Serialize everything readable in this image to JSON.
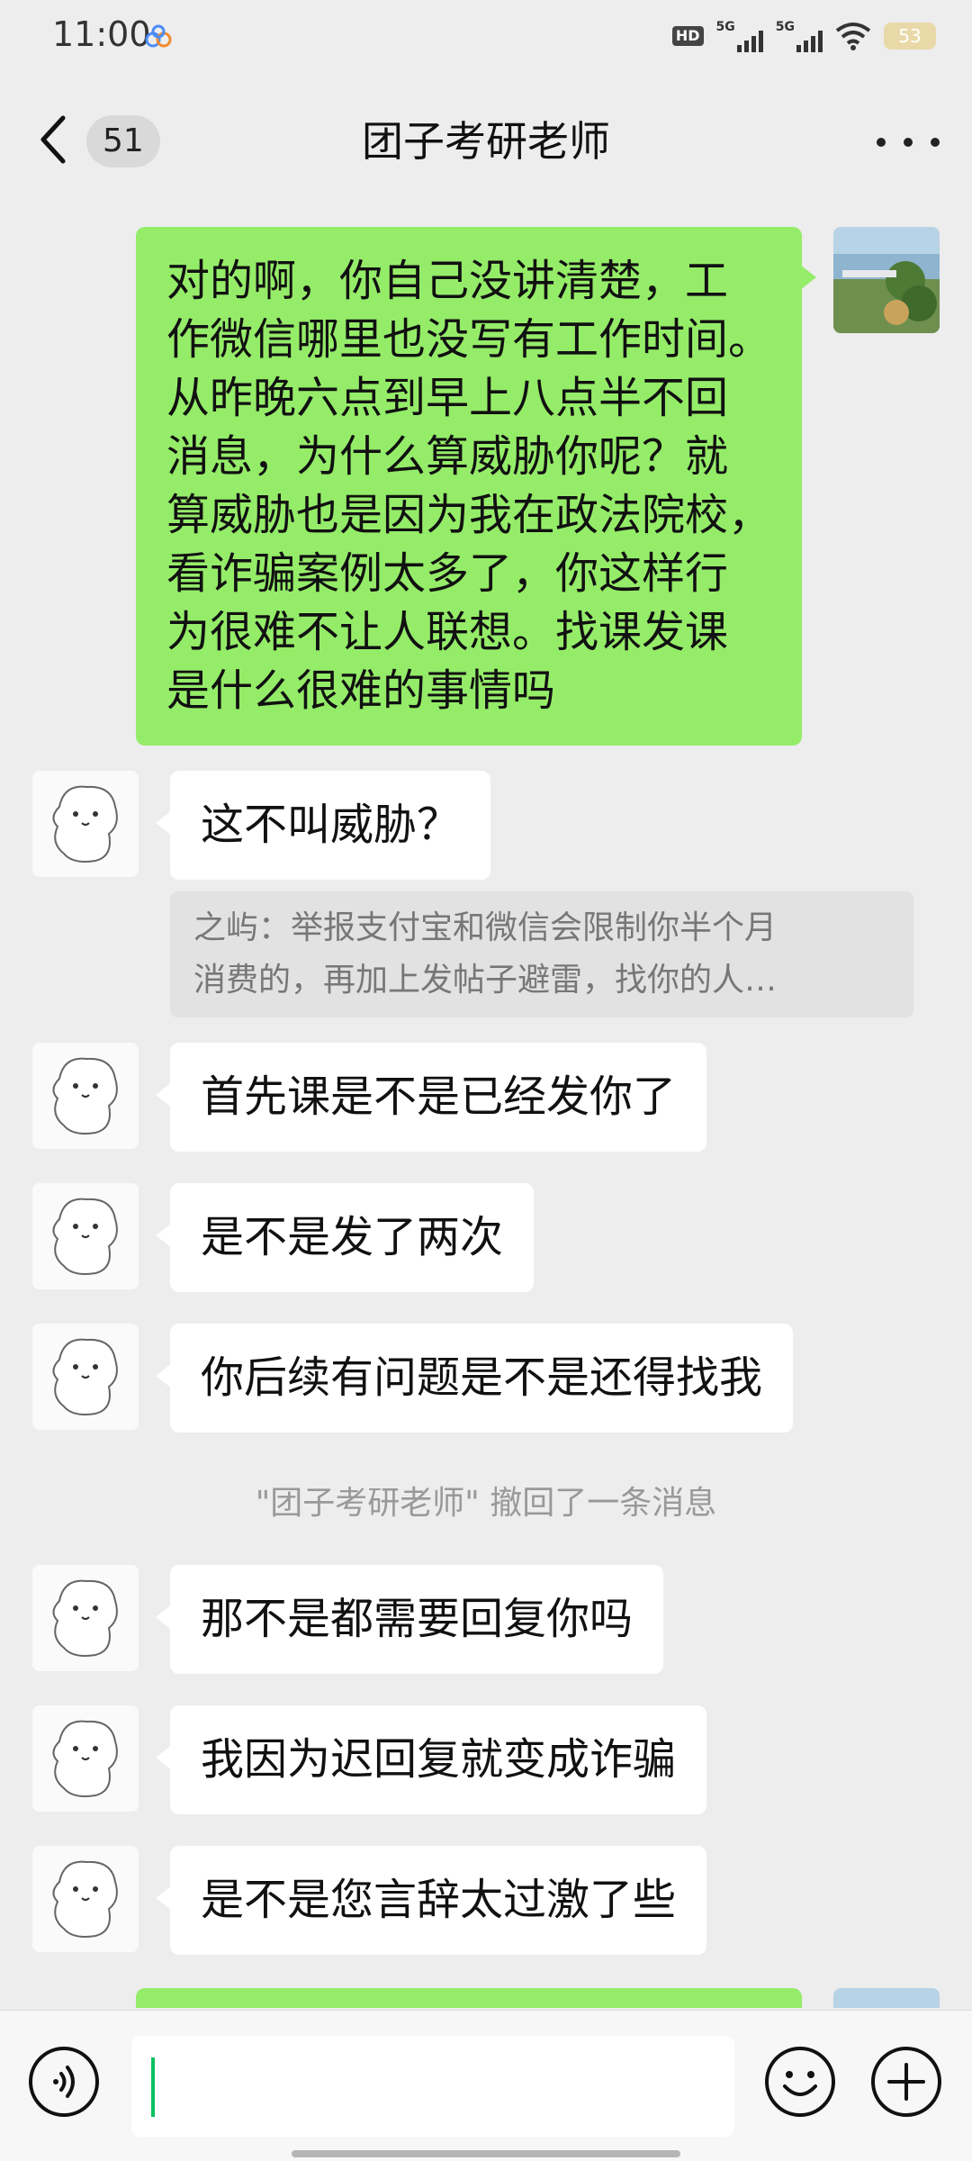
{
  "status_bar": {
    "time": "11:00",
    "battery": "53",
    "signal_1": "5G",
    "signal_2": "5G",
    "hd_badge": "HD"
  },
  "header": {
    "back_icon": "chevron-left-icon",
    "unread_count": "51",
    "title": "团子考研老师",
    "more_icon": "more-dots-icon"
  },
  "messages": [
    {
      "sender": "me",
      "lines": [
        "对的啊，你自己没讲清楚，工",
        "作微信哪里也没写有工作时间。",
        "从昨晚六点到早上八点半不回",
        "消息，为什么算威胁你呢？就",
        "算威胁也是因为我在政法院校，",
        "看诈骗案例太多了，你这样行",
        "为很难不让人联想。找课发课",
        "是什么很难的事情吗"
      ]
    },
    {
      "sender": "other",
      "text": "这不叫威胁？",
      "quote_line1": "之屿：举报支付宝和微信会限制你半个月",
      "quote_line2": "消费的，再加上发帖子避雷，找你的人…"
    },
    {
      "sender": "other",
      "text": "首先课是不是已经发你了"
    },
    {
      "sender": "other",
      "text": "是不是发了两次"
    },
    {
      "sender": "other",
      "text": "你后续有问题是不是还得找我"
    },
    {
      "sender": "system",
      "text": "\"团子考研老师\" 撤回了一条消息"
    },
    {
      "sender": "other",
      "text": "那不是都需要回复你吗"
    },
    {
      "sender": "other",
      "text": "我因为迟回复就变成诈骗"
    },
    {
      "sender": "other",
      "text": "是不是您言辞太过激了些"
    }
  ],
  "input_bar": {
    "voice_icon": "voice-icon",
    "input_value": "",
    "emoji_icon": "emoji-icon",
    "plus_icon": "plus-icon"
  },
  "colors": {
    "my_bubble": "#95ec69",
    "other_bubble": "#ffffff",
    "background": "#ededed",
    "caret": "#07c160"
  }
}
